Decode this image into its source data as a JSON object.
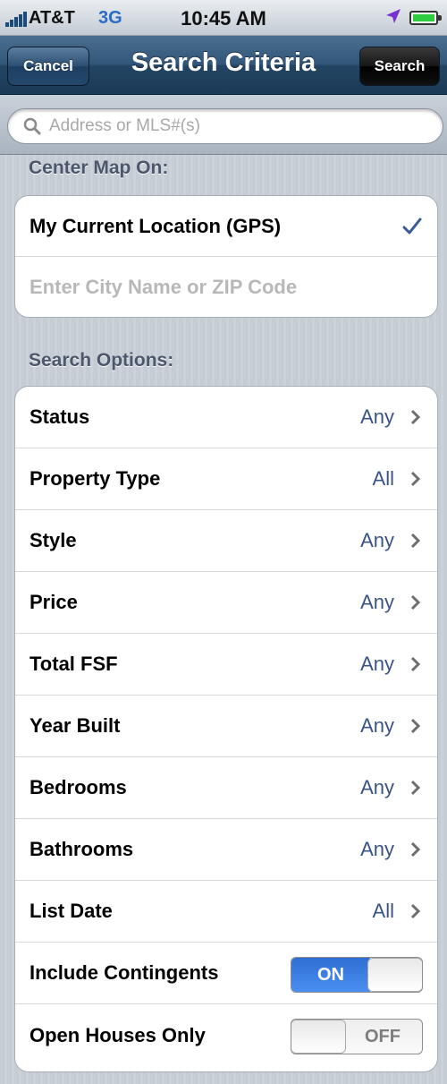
{
  "status_bar": {
    "carrier": "AT&T",
    "network": "3G",
    "time": "10:45 AM"
  },
  "nav": {
    "title": "Search Criteria",
    "cancel_label": "Cancel",
    "search_label": "Search"
  },
  "search": {
    "placeholder": "Address or MLS#(s)"
  },
  "center_map": {
    "header": "Center Map On:",
    "current_location_label": "My Current Location (GPS)",
    "current_location_selected": true,
    "city_placeholder": "Enter City Name or ZIP Code"
  },
  "search_options": {
    "header": "Search Options:",
    "rows": [
      {
        "label": "Status",
        "value": "Any"
      },
      {
        "label": "Property Type",
        "value": "All"
      },
      {
        "label": "Style",
        "value": "Any"
      },
      {
        "label": "Price",
        "value": "Any"
      },
      {
        "label": "Total FSF",
        "value": "Any"
      },
      {
        "label": "Year Built",
        "value": "Any"
      },
      {
        "label": "Bedrooms",
        "value": "Any"
      },
      {
        "label": "Bathrooms",
        "value": "Any"
      },
      {
        "label": "List Date",
        "value": "All"
      }
    ],
    "toggles": [
      {
        "label": "Include Contingents",
        "state_label": "ON",
        "on": true
      },
      {
        "label": "Open Houses Only",
        "state_label": "OFF",
        "on": false
      }
    ]
  },
  "colors": {
    "nav_bar": "#234463",
    "value_text": "#385487",
    "toggle_on": "#3a7fe3",
    "checkmark": "#3a5a9c"
  },
  "icons": [
    "signal-icon",
    "location-arrow-icon",
    "battery-icon",
    "search-icon",
    "checkmark-icon",
    "chevron-right-icon"
  ]
}
